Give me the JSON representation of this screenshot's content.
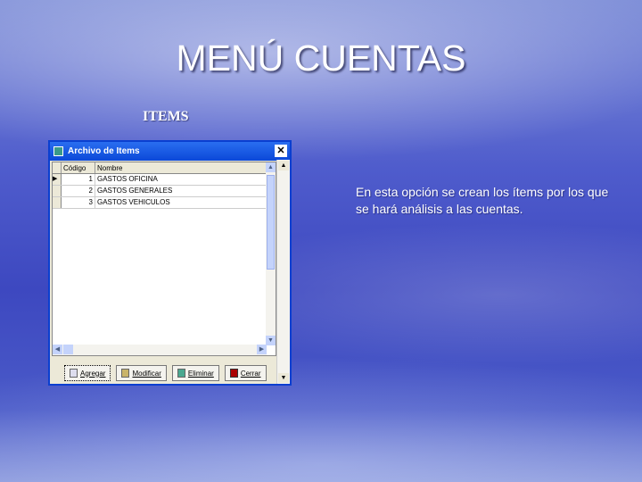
{
  "slide": {
    "title": "MENÚ CUENTAS",
    "subtitle": "ITEMS",
    "description": "En esta opción se crean los ítems por los que se hará análisis a las cuentas."
  },
  "dialog": {
    "title": "Archivo de Items",
    "columns": [
      "Código",
      "Nombre"
    ],
    "rows": [
      {
        "code": "1",
        "name": "GASTOS OFICINA"
      },
      {
        "code": "2",
        "name": "GASTOS GENERALES"
      },
      {
        "code": "3",
        "name": "GASTOS VEHICULOS"
      }
    ],
    "buttons": {
      "add": "Agregar",
      "edit": "Modificar",
      "delete": "Eliminar",
      "close": "Cerrar"
    }
  }
}
